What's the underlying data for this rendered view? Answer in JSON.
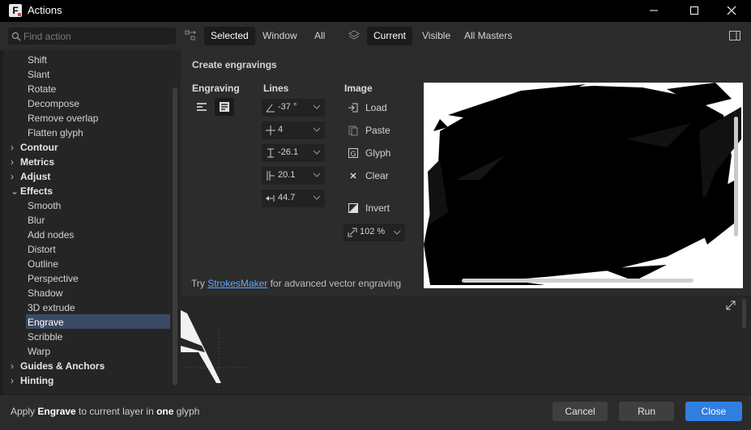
{
  "window": {
    "title": "Actions"
  },
  "toolbar": {
    "search_placeholder": "Find action",
    "scope_tabs": [
      "Selected",
      "Window",
      "All"
    ],
    "layer_tabs": [
      "Current",
      "Visible",
      "All Masters"
    ],
    "active_scope": "Selected",
    "active_layer": "Current"
  },
  "tree": {
    "items_top": [
      "Shift",
      "Slant",
      "Rotate",
      "Decompose",
      "Remove overlap",
      "Flatten glyph"
    ],
    "categories": {
      "contour": "Contour",
      "metrics": "Metrics",
      "adjust": "Adjust",
      "effects": "Effects",
      "guides": "Guides & Anchors",
      "hinting": "Hinting"
    },
    "effects_items": [
      "Smooth",
      "Blur",
      "Add nodes",
      "Distort",
      "Outline",
      "Perspective",
      "Shadow",
      "3D extrude",
      "Engrave",
      "Scribble",
      "Warp"
    ],
    "selected": "Engrave"
  },
  "panel": {
    "title": "Create engravings",
    "col_engraving": "Engraving",
    "col_lines": "Lines",
    "col_image": "Image",
    "lines": {
      "angle": "-37 °",
      "count": "4",
      "offset": "-26.1",
      "width": "20.1",
      "spacing": "44.7"
    },
    "image_actions": {
      "load": "Load",
      "paste": "Paste",
      "glyph": "Glyph",
      "clear": "Clear",
      "invert": "Invert"
    },
    "zoom": "102 %",
    "hint_prefix": "Try ",
    "hint_link": "StrokesMaker",
    "hint_suffix": " for advanced vector engraving"
  },
  "footer": {
    "status_1": "Apply ",
    "status_action": "Engrave",
    "status_2": " to current layer in ",
    "status_scope": "one",
    "status_3": " glyph",
    "cancel": "Cancel",
    "run": "Run",
    "close": "Close"
  },
  "colors": {
    "accent": "#2f7fe0",
    "selection": "#3b4a63",
    "link": "#5fa9ff"
  }
}
